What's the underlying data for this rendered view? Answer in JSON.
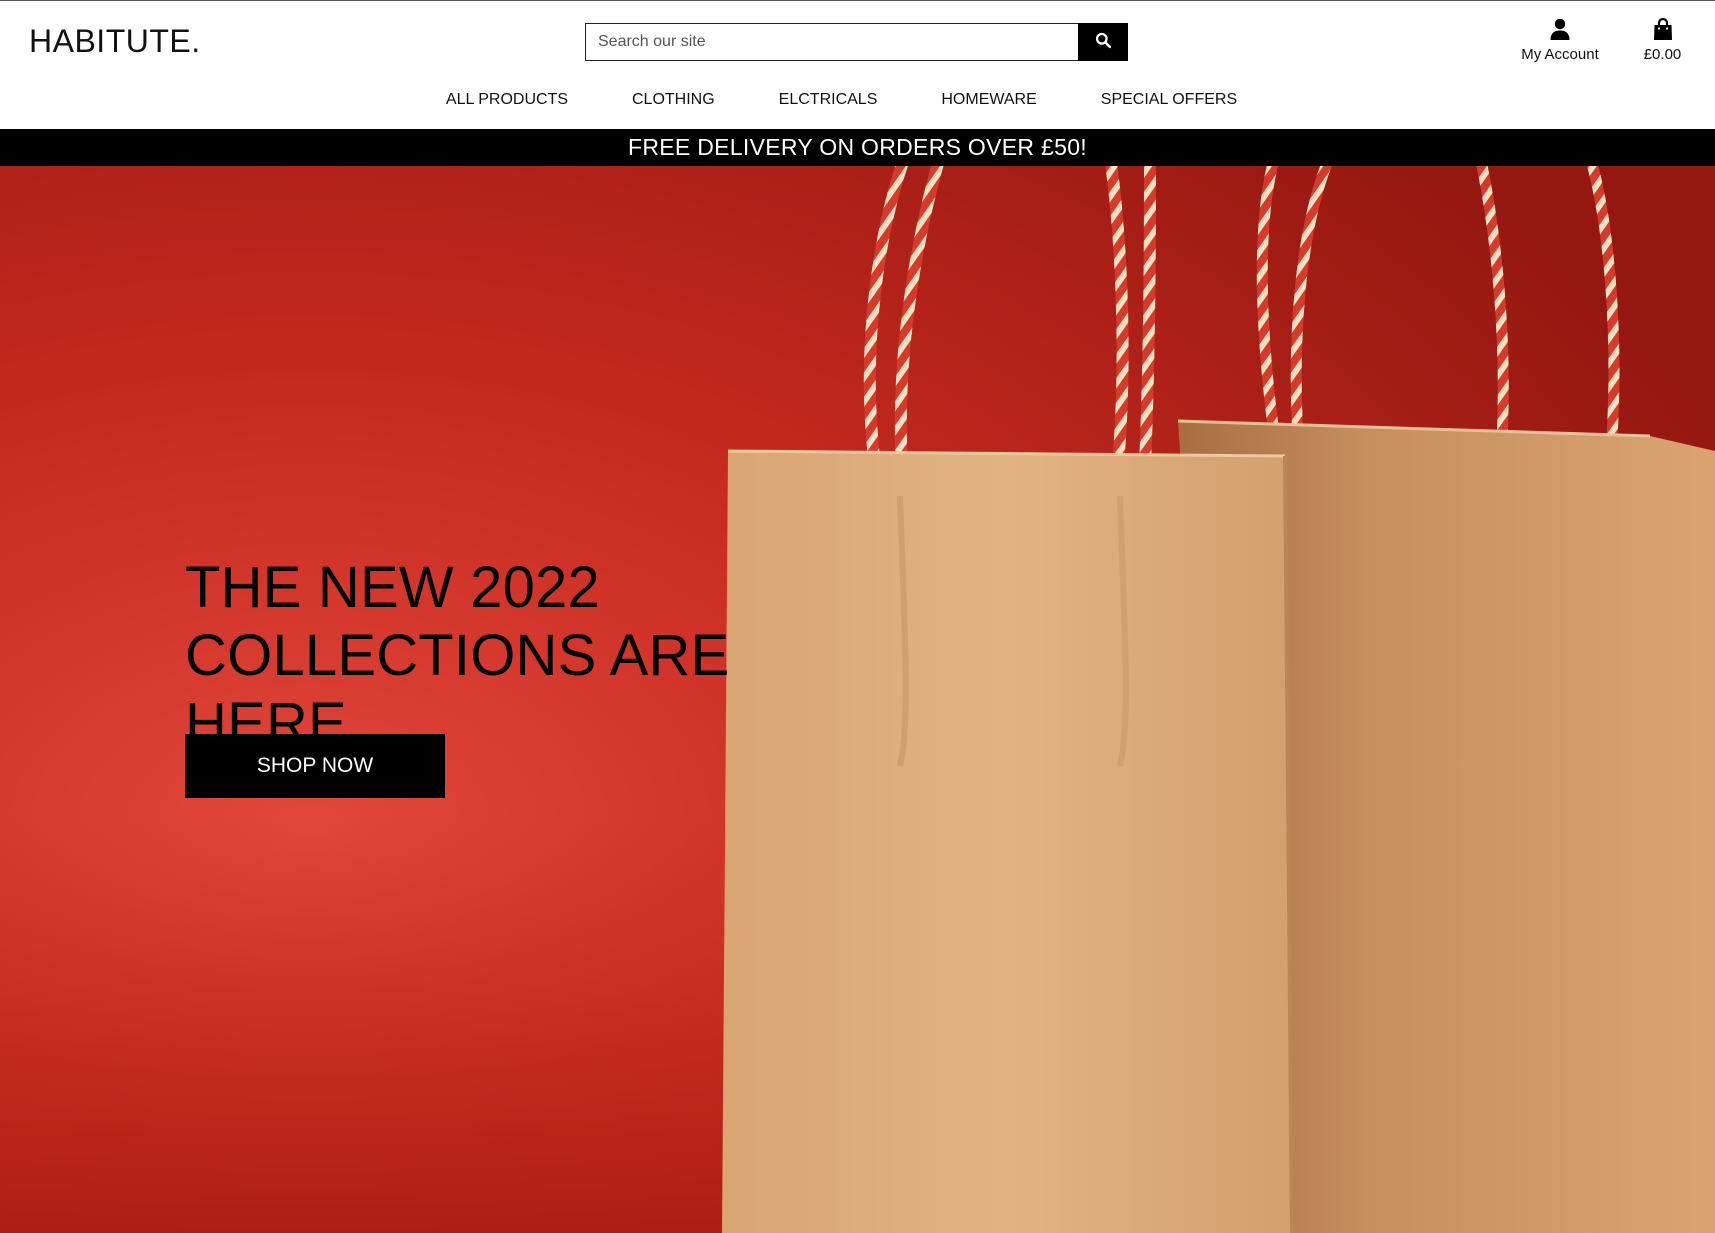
{
  "brand": {
    "logo_text": "HABITUTE."
  },
  "search": {
    "placeholder": "Search our site"
  },
  "account": {
    "label": "My Account",
    "icon": "user-icon"
  },
  "bag": {
    "total": "£0.00",
    "icon": "shopping-bag-icon"
  },
  "nav": {
    "items": [
      {
        "label": "ALL PRODUCTS"
      },
      {
        "label": "CLOTHING"
      },
      {
        "label": "ELCTRICALS"
      },
      {
        "label": "HOMEWARE"
      },
      {
        "label": "SPECIAL OFFERS"
      }
    ]
  },
  "banner": {
    "text": "FREE DELIVERY ON ORDERS OVER £50!"
  },
  "hero": {
    "line1": "THE NEW 2022",
    "line2": "COLLECTIONS ARE HERE",
    "cta": "SHOP NOW",
    "image": "paper-shopping-bags-on-red"
  },
  "colors": {
    "banner_bg": "#000000",
    "hero_red": "#c8261e",
    "bag_kraft": "#d9a774",
    "cta_bg": "#000000"
  }
}
